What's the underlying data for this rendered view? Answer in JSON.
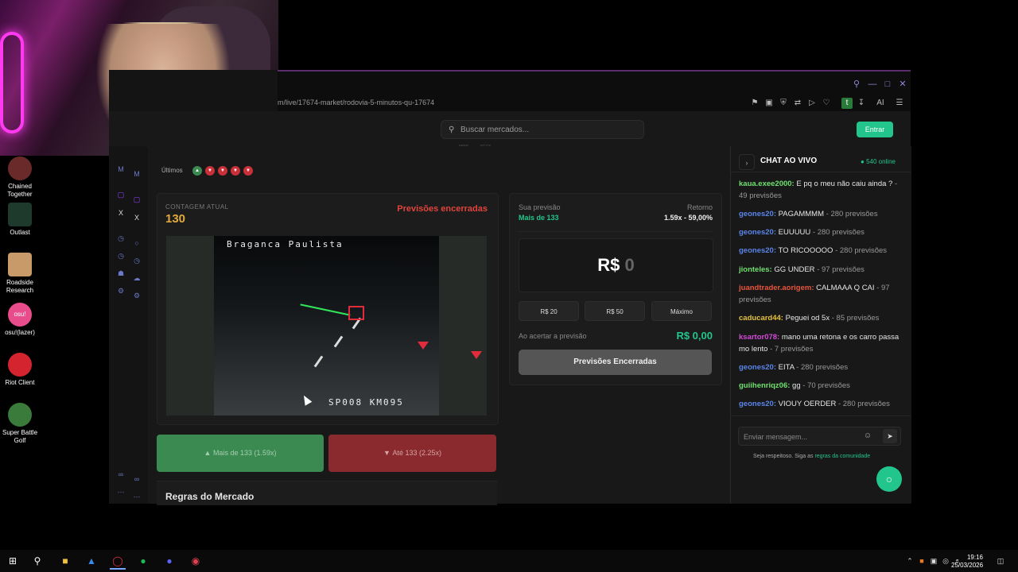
{
  "desktop_icons": [
    {
      "label": "Chained Together",
      "color": "#6a2a2a"
    },
    {
      "label": "Outlast",
      "color": "#1e3a2c"
    },
    {
      "label": "Roadside Research",
      "color": "#c89a6a"
    },
    {
      "label": "osu!(lazer)",
      "color": "#e84c8a"
    },
    {
      "label": "Riot Client",
      "color": "#d3242f"
    },
    {
      "label": "Super Battle Golf",
      "color": "#3a7a3a"
    }
  ],
  "browser": {
    "url": "m/live/17674-market/rodovia-5-minutos-qu-17674",
    "toolbar_ai": "AI",
    "user_initial": "t"
  },
  "header": {
    "search_placeholder": "Buscar mercados...",
    "login_label": "Entrar",
    "timer_labels": [
      "MINS",
      "SECS"
    ]
  },
  "market": {
    "ultimos_label": "Últimos",
    "ultimos": [
      "up",
      "down",
      "down",
      "down",
      "down"
    ],
    "count_label": "CONTAGEM ATUAL",
    "count": "130",
    "status": "Previsões encerradas",
    "camera_title": "Braganca Paulista",
    "camera_footer": "SP008  KM095",
    "btn_up": "Mais de 133 (1.59x)",
    "btn_down": "Até 133 (2.25x)",
    "rules_title": "Regras do Mercado",
    "colors": {
      "up": "#3a8a52",
      "down": "#8b2a2e",
      "accent": "#22c58b",
      "count": "#e3a93e"
    }
  },
  "bet": {
    "your_label": "Sua previsão",
    "your_value": "Mais de 133",
    "return_label": "Retorno",
    "return_value": "1.59x - 59,00%",
    "currency": "R$",
    "amount": "0",
    "chips": [
      "R$ 20",
      "R$ 50",
      "Máximo"
    ],
    "win_label": "Ao acertar a previsão",
    "win_value": "R$ 0,00",
    "action": "Previsões Encerradas"
  },
  "chat": {
    "title": "CHAT AO VIVO",
    "online": "540 online",
    "messages": [
      {
        "user": "kaua.exee2000:",
        "text": "E pq o meu não caiu ainda ?",
        "meta": "- 49 previsões",
        "color": "#6fe06f"
      },
      {
        "user": "geones20:",
        "text": "PAGAMMMM",
        "meta": "- 280 previsões",
        "color": "#5b84e8"
      },
      {
        "user": "geones20:",
        "text": "EUUUUU",
        "meta": "- 280 previsões",
        "color": "#5b84e8"
      },
      {
        "user": "geones20:",
        "text": "TO RICOOOOO",
        "meta": "- 280 previsões",
        "color": "#5b84e8"
      },
      {
        "user": "jionteles:",
        "text": "GG UNDER",
        "meta": "- 97 previsões",
        "color": "#6fe06f"
      },
      {
        "user": "juandtrader.aorigem:",
        "text": "CALMAAA Q CAI",
        "meta": "- 97 previsões",
        "color": "#e8553c"
      },
      {
        "user": "caducard44:",
        "text": "Peguei od 5x",
        "meta": "- 85 previsões",
        "color": "#e6c23a"
      },
      {
        "user": "ksartor078:",
        "text": "mano uma retona e os carro passa mo lento",
        "meta": "- 7 previsões",
        "color": "#d24ad8"
      },
      {
        "user": "geones20:",
        "text": "EITA",
        "meta": "- 280 previsões",
        "color": "#5b84e8"
      },
      {
        "user": "guiihenriqz06:",
        "text": "gg",
        "meta": "- 70 previsões",
        "color": "#6fe06f"
      },
      {
        "user": "geones20:",
        "text": "VIOUY OERDER",
        "meta": "- 280 previsões",
        "color": "#5b84e8"
      }
    ],
    "input_placeholder": "Enviar mensagem...",
    "respect_text": "Seja respeitoso. Siga as",
    "respect_link": "regras da comunidade"
  },
  "taskbar": {
    "time": "19:16",
    "date": "25/03/2026"
  }
}
